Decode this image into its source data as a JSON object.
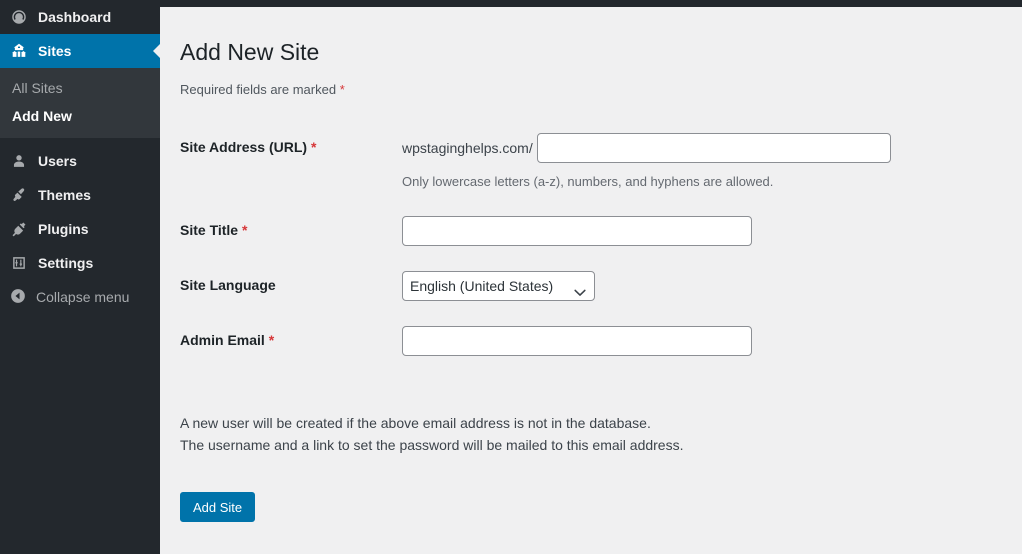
{
  "sidebar": {
    "items": [
      {
        "label": "Dashboard",
        "icon": "dashboard-icon",
        "name": "dashboard",
        "active": false
      },
      {
        "label": "Sites",
        "icon": "multisite-icon",
        "name": "sites",
        "active": true
      },
      {
        "label": "Users",
        "icon": "users-icon",
        "name": "users",
        "active": false
      },
      {
        "label": "Themes",
        "icon": "themes-icon",
        "name": "themes",
        "active": false
      },
      {
        "label": "Plugins",
        "icon": "plugins-icon",
        "name": "plugins",
        "active": false
      },
      {
        "label": "Settings",
        "icon": "settings-icon",
        "name": "settings",
        "active": false
      }
    ],
    "submenu": [
      {
        "label": "All Sites",
        "current": false
      },
      {
        "label": "Add New",
        "current": true
      }
    ],
    "collapse": {
      "label": "Collapse menu",
      "icon": "collapse-left-arrow-icon"
    },
    "active_color": "#0073aa",
    "background_color": "#23282d",
    "submenu_background_color": "#32373c"
  },
  "main": {
    "title": "Add New Site",
    "required_note": "Required fields are marked",
    "required_marker": "*",
    "fields": {
      "site_address": {
        "label": "Site Address (URL)",
        "required_marker": "*",
        "url_prefix": "wpstaginghelps.com/",
        "value": "",
        "placeholder": "",
        "description": "Only lowercase letters (a-z), numbers, and hyphens are allowed."
      },
      "site_title": {
        "label": "Site Title",
        "required_marker": "*",
        "value": "",
        "placeholder": ""
      },
      "site_language": {
        "label": "Site Language",
        "selected": "English (United States)",
        "options": [
          "English (United States)"
        ]
      },
      "admin_email": {
        "label": "Admin Email",
        "required_marker": "*",
        "value": "",
        "placeholder": ""
      }
    },
    "notes": [
      "A new user will be created if the above email address is not in the database.",
      "The username and a link to set the password will be mailed to this email address."
    ],
    "submit_label": "Add Site",
    "accent_color": "#0073aa",
    "required_color": "#d63638"
  }
}
